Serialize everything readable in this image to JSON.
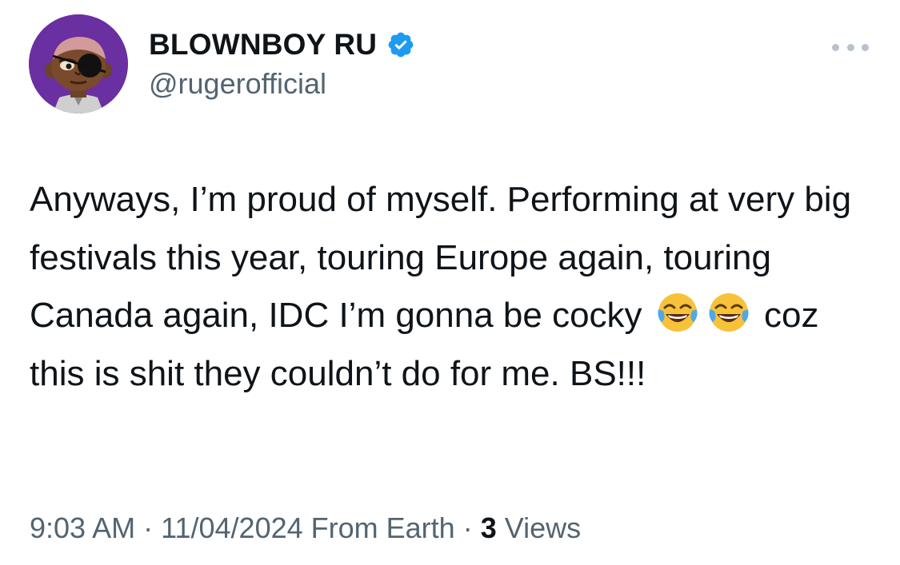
{
  "author": {
    "display_name": "BLOWNBOY RU",
    "handle": "@rugerofficial",
    "verified_icon": "verified-badge-icon",
    "avatar_icon": "cartoon-avatar"
  },
  "menu_icon": "more-options-icon",
  "tweet": {
    "text_before_emoji": "Anyways, I’m proud of myself. Performing at very big festivals this year, touring Europe again, touring Canada again, IDC I’m gonna be cocky",
    "emoji_1": "face-with-tears-of-joy",
    "emoji_2": "face-with-tears-of-joy",
    "text_after_emoji": "coz this is shit they couldn’t do for me. BS!!!"
  },
  "meta": {
    "time": "9:03 AM",
    "sep1": "·",
    "date": "11/04/2024",
    "source": "From Earth",
    "sep2": "·",
    "views_count": "3",
    "views_label": "Views"
  },
  "colors": {
    "text": "#0f1419",
    "secondary": "#536471",
    "verified_blue": "#1d9bf0",
    "avatar_bg": "#6a2fa0"
  }
}
